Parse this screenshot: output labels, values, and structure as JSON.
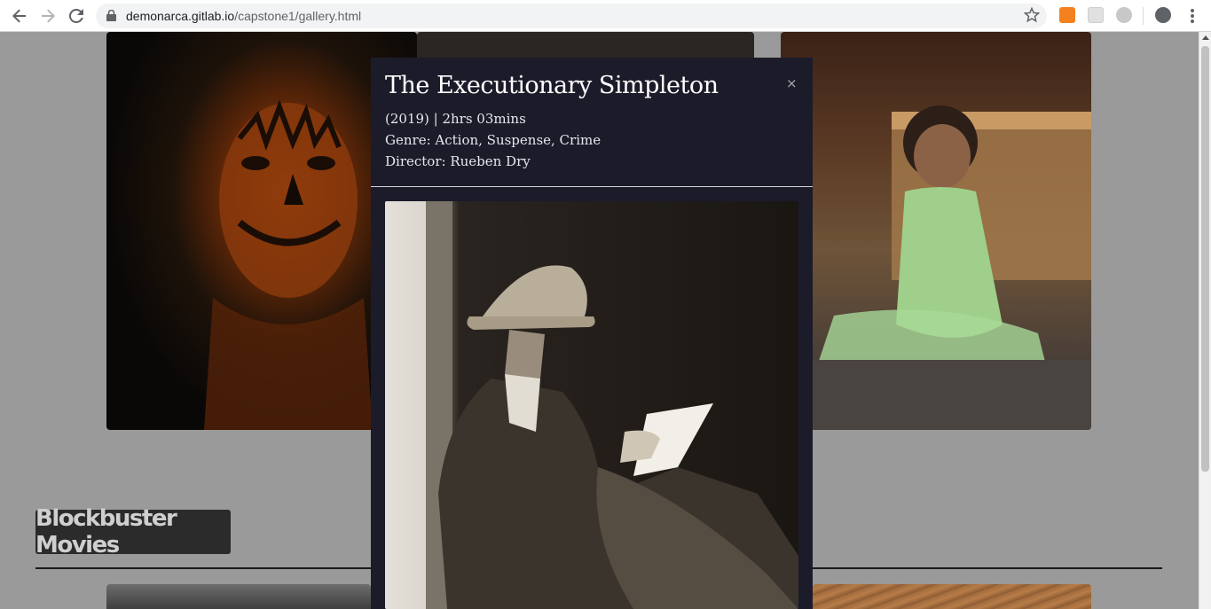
{
  "browser": {
    "url_host": "demonarca.gitlab.io",
    "url_path": "/capstone1/gallery.html"
  },
  "page": {
    "section_title": "Blockbuster Movies"
  },
  "modal": {
    "title": "The Executionary Simpleton",
    "meta": "(2019) | 2hrs 03mins",
    "genre": "Genre: Action, Suspense, Crime",
    "director": "Director: Rueben Dry",
    "close_label": "×"
  },
  "colors": {
    "modal_bg": "#1c1b2a",
    "page_overlay": "#9a9a9a",
    "section_title_bg": "#2b2b2b"
  }
}
